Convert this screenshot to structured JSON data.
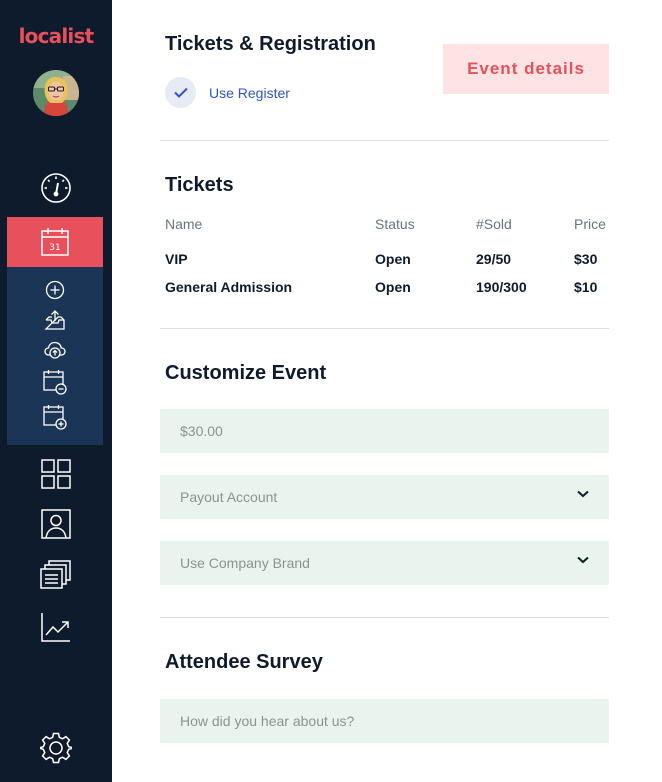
{
  "app": {
    "logo_text": "localist"
  },
  "sidebar": {
    "items": [
      {
        "name": "dashboard",
        "icon": "gauge-icon"
      },
      {
        "name": "calendar",
        "icon": "calendar-icon",
        "active": true,
        "label": "31"
      },
      {
        "name": "add-event",
        "icon": "plus-circle-icon"
      },
      {
        "name": "import",
        "icon": "inbox-upload-icon"
      },
      {
        "name": "cloud-upload",
        "icon": "cloud-upload-icon"
      },
      {
        "name": "calendar-remove",
        "icon": "calendar-minus-icon"
      },
      {
        "name": "calendar-add",
        "icon": "calendar-plus-icon"
      },
      {
        "name": "widgets",
        "icon": "grid-icon"
      },
      {
        "name": "people",
        "icon": "user-icon"
      },
      {
        "name": "pages",
        "icon": "documents-icon"
      },
      {
        "name": "analytics",
        "icon": "chart-icon"
      },
      {
        "name": "settings",
        "icon": "gear-icon"
      }
    ],
    "accent": "#e8505b",
    "background": "#0e1b2c"
  },
  "registration": {
    "title": "Tickets & Registration",
    "toggle_label": "Use Register",
    "event_details_button": "Event details"
  },
  "tickets": {
    "title": "Tickets",
    "columns": [
      "Name",
      "Status",
      "#Sold",
      "Price"
    ],
    "rows": [
      {
        "name": "VIP",
        "status": "Open",
        "sold": "29/50",
        "price": "$30"
      },
      {
        "name": "General Admission",
        "status": "Open",
        "sold": "190/300",
        "price": "$10"
      }
    ]
  },
  "customize": {
    "title": "Customize Event",
    "price_value": "$30.00",
    "payout_placeholder": "Payout Account",
    "brand_placeholder": "Use Company Brand"
  },
  "survey": {
    "title": "Attendee Survey",
    "question_placeholder": "How did you hear about us?"
  }
}
